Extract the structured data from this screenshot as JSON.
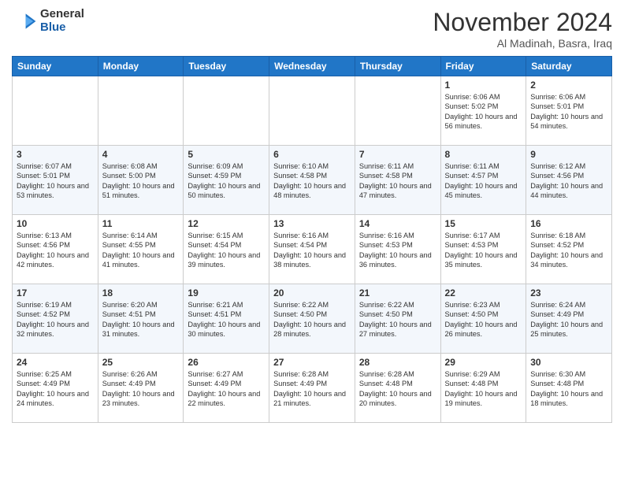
{
  "logo": {
    "general": "General",
    "blue": "Blue"
  },
  "header": {
    "month": "November 2024",
    "location": "Al Madinah, Basra, Iraq"
  },
  "weekdays": [
    "Sunday",
    "Monday",
    "Tuesday",
    "Wednesday",
    "Thursday",
    "Friday",
    "Saturday"
  ],
  "weeks": [
    [
      {
        "day": "",
        "info": ""
      },
      {
        "day": "",
        "info": ""
      },
      {
        "day": "",
        "info": ""
      },
      {
        "day": "",
        "info": ""
      },
      {
        "day": "",
        "info": ""
      },
      {
        "day": "1",
        "info": "Sunrise: 6:06 AM\nSunset: 5:02 PM\nDaylight: 10 hours and 56 minutes."
      },
      {
        "day": "2",
        "info": "Sunrise: 6:06 AM\nSunset: 5:01 PM\nDaylight: 10 hours and 54 minutes."
      }
    ],
    [
      {
        "day": "3",
        "info": "Sunrise: 6:07 AM\nSunset: 5:01 PM\nDaylight: 10 hours and 53 minutes."
      },
      {
        "day": "4",
        "info": "Sunrise: 6:08 AM\nSunset: 5:00 PM\nDaylight: 10 hours and 51 minutes."
      },
      {
        "day": "5",
        "info": "Sunrise: 6:09 AM\nSunset: 4:59 PM\nDaylight: 10 hours and 50 minutes."
      },
      {
        "day": "6",
        "info": "Sunrise: 6:10 AM\nSunset: 4:58 PM\nDaylight: 10 hours and 48 minutes."
      },
      {
        "day": "7",
        "info": "Sunrise: 6:11 AM\nSunset: 4:58 PM\nDaylight: 10 hours and 47 minutes."
      },
      {
        "day": "8",
        "info": "Sunrise: 6:11 AM\nSunset: 4:57 PM\nDaylight: 10 hours and 45 minutes."
      },
      {
        "day": "9",
        "info": "Sunrise: 6:12 AM\nSunset: 4:56 PM\nDaylight: 10 hours and 44 minutes."
      }
    ],
    [
      {
        "day": "10",
        "info": "Sunrise: 6:13 AM\nSunset: 4:56 PM\nDaylight: 10 hours and 42 minutes."
      },
      {
        "day": "11",
        "info": "Sunrise: 6:14 AM\nSunset: 4:55 PM\nDaylight: 10 hours and 41 minutes."
      },
      {
        "day": "12",
        "info": "Sunrise: 6:15 AM\nSunset: 4:54 PM\nDaylight: 10 hours and 39 minutes."
      },
      {
        "day": "13",
        "info": "Sunrise: 6:16 AM\nSunset: 4:54 PM\nDaylight: 10 hours and 38 minutes."
      },
      {
        "day": "14",
        "info": "Sunrise: 6:16 AM\nSunset: 4:53 PM\nDaylight: 10 hours and 36 minutes."
      },
      {
        "day": "15",
        "info": "Sunrise: 6:17 AM\nSunset: 4:53 PM\nDaylight: 10 hours and 35 minutes."
      },
      {
        "day": "16",
        "info": "Sunrise: 6:18 AM\nSunset: 4:52 PM\nDaylight: 10 hours and 34 minutes."
      }
    ],
    [
      {
        "day": "17",
        "info": "Sunrise: 6:19 AM\nSunset: 4:52 PM\nDaylight: 10 hours and 32 minutes."
      },
      {
        "day": "18",
        "info": "Sunrise: 6:20 AM\nSunset: 4:51 PM\nDaylight: 10 hours and 31 minutes."
      },
      {
        "day": "19",
        "info": "Sunrise: 6:21 AM\nSunset: 4:51 PM\nDaylight: 10 hours and 30 minutes."
      },
      {
        "day": "20",
        "info": "Sunrise: 6:22 AM\nSunset: 4:50 PM\nDaylight: 10 hours and 28 minutes."
      },
      {
        "day": "21",
        "info": "Sunrise: 6:22 AM\nSunset: 4:50 PM\nDaylight: 10 hours and 27 minutes."
      },
      {
        "day": "22",
        "info": "Sunrise: 6:23 AM\nSunset: 4:50 PM\nDaylight: 10 hours and 26 minutes."
      },
      {
        "day": "23",
        "info": "Sunrise: 6:24 AM\nSunset: 4:49 PM\nDaylight: 10 hours and 25 minutes."
      }
    ],
    [
      {
        "day": "24",
        "info": "Sunrise: 6:25 AM\nSunset: 4:49 PM\nDaylight: 10 hours and 24 minutes."
      },
      {
        "day": "25",
        "info": "Sunrise: 6:26 AM\nSunset: 4:49 PM\nDaylight: 10 hours and 23 minutes."
      },
      {
        "day": "26",
        "info": "Sunrise: 6:27 AM\nSunset: 4:49 PM\nDaylight: 10 hours and 22 minutes."
      },
      {
        "day": "27",
        "info": "Sunrise: 6:28 AM\nSunset: 4:49 PM\nDaylight: 10 hours and 21 minutes."
      },
      {
        "day": "28",
        "info": "Sunrise: 6:28 AM\nSunset: 4:48 PM\nDaylight: 10 hours and 20 minutes."
      },
      {
        "day": "29",
        "info": "Sunrise: 6:29 AM\nSunset: 4:48 PM\nDaylight: 10 hours and 19 minutes."
      },
      {
        "day": "30",
        "info": "Sunrise: 6:30 AM\nSunset: 4:48 PM\nDaylight: 10 hours and 18 minutes."
      }
    ]
  ]
}
